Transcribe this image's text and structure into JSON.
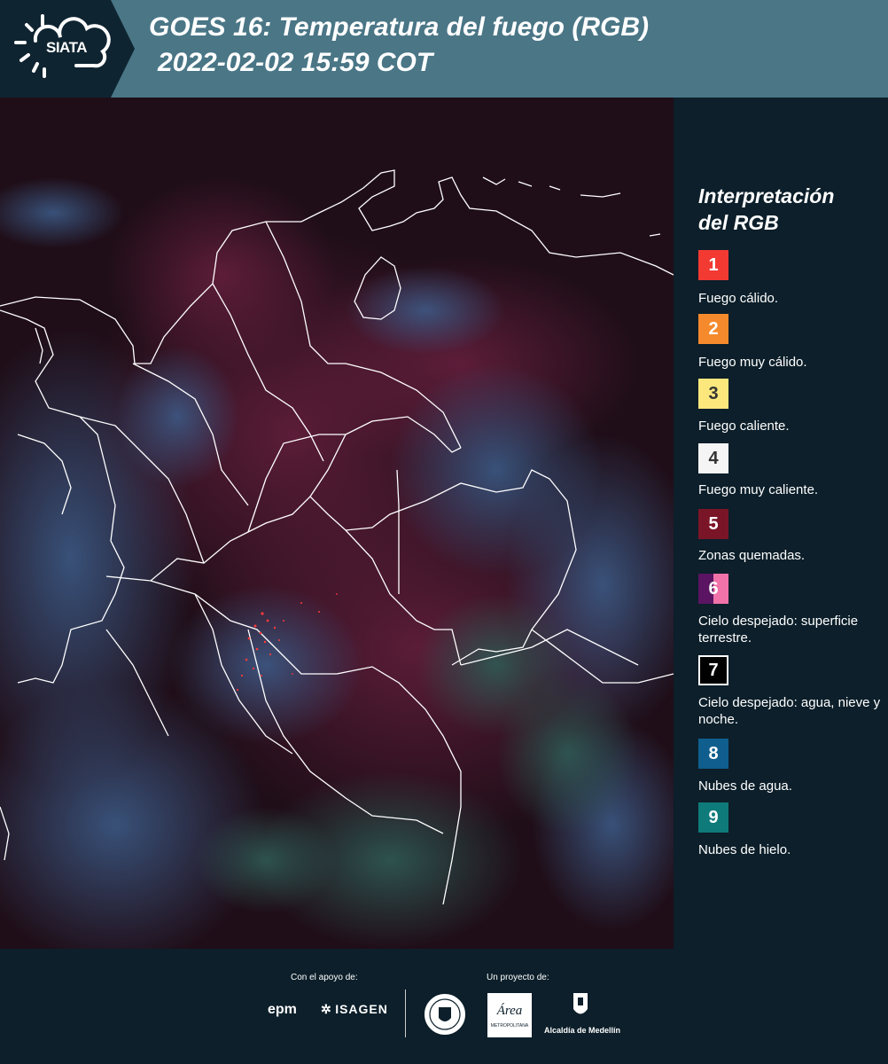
{
  "header": {
    "logo_text": "SIATA",
    "title_line1": "GOES 16: Temperatura del fuego (RGB)",
    "title_line2": "2022-02-02 15:59 COT"
  },
  "legend": {
    "title_line1": "Interpretación",
    "title_line2": "del RGB",
    "items": [
      {
        "number": "1",
        "label": "Fuego cálido.",
        "color": "#f23a33",
        "text_color": "#ffffff"
      },
      {
        "number": "2",
        "label": "Fuego muy cálido.",
        "color": "#f58a2c",
        "text_color": "#ffffff"
      },
      {
        "number": "3",
        "label": "Fuego caliente.",
        "color": "#fbe77c",
        "text_color": "#333333"
      },
      {
        "number": "4",
        "label": "Fuego muy caliente.",
        "color": "#f5f5f5",
        "text_color": "#333333"
      },
      {
        "number": "5",
        "label": "Zonas quemadas.",
        "color": "#7a1527",
        "text_color": "#ffffff"
      },
      {
        "number": "6",
        "label": "Cielo despejado: superficie terrestre.",
        "color": "#5a1462",
        "color2": "#f072a8",
        "text_color": "#ffffff"
      },
      {
        "number": "7",
        "label": "Cielo despejado: agua, nieve y noche.",
        "color": "#000000",
        "text_color": "#ffffff"
      },
      {
        "number": "8",
        "label": "Nubes de agua.",
        "color": "#0f5e8e",
        "text_color": "#ffffff"
      },
      {
        "number": "9",
        "label": "Nubes de hielo.",
        "color": "#0f7a7a",
        "text_color": "#ffffff"
      }
    ]
  },
  "footer": {
    "support_caption": "Con el apoyo de:",
    "project_caption": "Un proyecto de:",
    "epm_text": "epm",
    "isagen_text": "ISAGEN",
    "area_text": "Área",
    "area_subtext": "METROPOLITANA",
    "alcaldia_text": "Alcaldía de Medellín"
  }
}
